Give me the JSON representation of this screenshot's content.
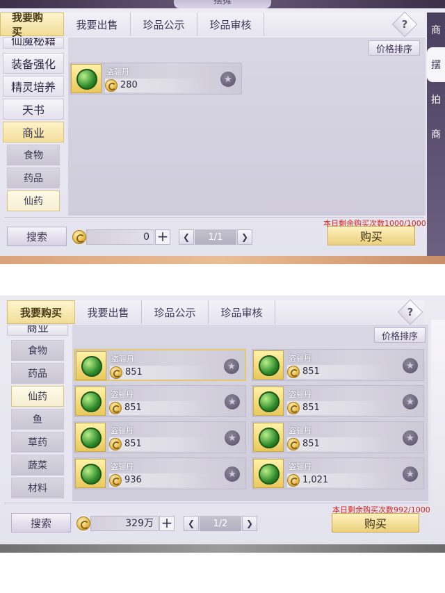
{
  "panel1": {
    "stall_title": "摆摊",
    "tabs": [
      {
        "label": "我要购买",
        "active": true
      },
      {
        "label": "我要出售"
      },
      {
        "label": "珍品公示"
      },
      {
        "label": "珍品审核"
      }
    ],
    "help": "?",
    "right_side": [
      "商",
      "摆",
      "拍",
      "商"
    ],
    "sort_label": "价格排序",
    "categories": [
      {
        "label": "仙魔秘籍",
        "level": "main"
      },
      {
        "label": "装备强化",
        "level": "main"
      },
      {
        "label": "精灵培养",
        "level": "main"
      },
      {
        "label": "天书",
        "level": "main"
      },
      {
        "label": "商业",
        "level": "main",
        "selected": true
      },
      {
        "label": "食物",
        "level": "sub"
      },
      {
        "label": "药品",
        "level": "sub"
      },
      {
        "label": "仙药",
        "level": "sub",
        "selected": true
      }
    ],
    "items": [
      {
        "name": "盗骊丹",
        "price": "280"
      }
    ],
    "search_label": "搜索",
    "amount": "0",
    "page": "1/1",
    "remain_text": "本日剩余购买次数1000/1000",
    "buy_label": "购买"
  },
  "panel2": {
    "tabs": [
      {
        "label": "我要购买",
        "active": true
      },
      {
        "label": "我要出售"
      },
      {
        "label": "珍品公示"
      },
      {
        "label": "珍品审核"
      }
    ],
    "help": "?",
    "sort_label": "价格排序",
    "categories": [
      {
        "label": "商业",
        "level": "main"
      },
      {
        "label": "食物",
        "level": "sub"
      },
      {
        "label": "药品",
        "level": "sub"
      },
      {
        "label": "仙药",
        "level": "sub",
        "selected": true
      },
      {
        "label": "鱼",
        "level": "sub"
      },
      {
        "label": "草药",
        "level": "sub"
      },
      {
        "label": "蔬菜",
        "level": "sub"
      },
      {
        "label": "材料",
        "level": "sub"
      }
    ],
    "items": [
      {
        "name": "盗骊丹",
        "price": "851",
        "highlight": true
      },
      {
        "name": "盗骊丹",
        "price": "851"
      },
      {
        "name": "盗骊丹",
        "price": "851"
      },
      {
        "name": "盗骊丹",
        "price": "851"
      },
      {
        "name": "盗骊丹",
        "price": "851"
      },
      {
        "name": "盗骊丹",
        "price": "851"
      },
      {
        "name": "盗骊丹",
        "price": "936"
      },
      {
        "name": "盗骊丹",
        "price": "1,021"
      }
    ],
    "search_label": "搜索",
    "amount": "329万",
    "page": "1/2",
    "remain_text": "本日剩余购买次数992/1000",
    "buy_label": "购买"
  },
  "icons": {
    "plus": "+",
    "prev": "❮",
    "next": "❯",
    "star": "★"
  }
}
